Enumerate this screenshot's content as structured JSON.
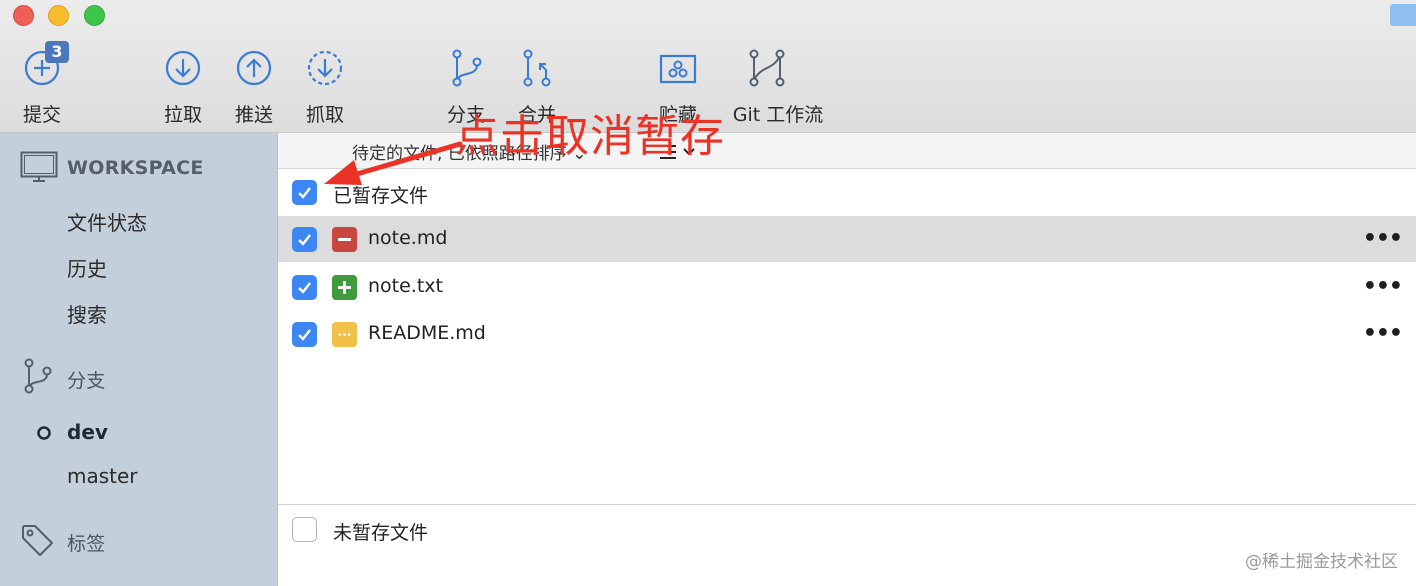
{
  "toolbar": {
    "commit": {
      "label": "提交",
      "badge": "3"
    },
    "pull": {
      "label": "拉取"
    },
    "push": {
      "label": "推送"
    },
    "fetch": {
      "label": "抓取"
    },
    "branch": {
      "label": "分支"
    },
    "merge": {
      "label": "合并"
    },
    "stash": {
      "label": "贮藏"
    },
    "gitflow": {
      "label": "Git 工作流"
    }
  },
  "sidebar": {
    "workspace_title": "WORKSPACE",
    "workspace_items": [
      "文件状态",
      "历史",
      "搜索"
    ],
    "branches_title": "分支",
    "branches": [
      {
        "name": "dev",
        "current": true
      },
      {
        "name": "master",
        "current": false
      }
    ],
    "tags_title": "标签"
  },
  "main": {
    "sort_label": "待定的文件, 已依照路径排序 ⌄",
    "list_mode_icon": "list-icon",
    "staged_title": "已暂存文件",
    "staged_files": [
      {
        "name": "note.md",
        "status": "removed",
        "selected": true
      },
      {
        "name": "note.txt",
        "status": "added",
        "selected": false
      },
      {
        "name": "README.md",
        "status": "modified",
        "selected": false
      }
    ],
    "more_label": "•••",
    "unstaged_title": "未暂存文件"
  },
  "annotation": {
    "text": "点击取消暂存",
    "color": "#ea3326"
  },
  "watermark": "@稀土掘金技术社区",
  "colors": {
    "checkbox_on": "#3d87f5",
    "status_removed": "#c9473e",
    "status_added": "#3f9b3c",
    "status_modified": "#f0c048",
    "sidebar_bg": "#c4cfdc",
    "accent_icon": "#3a7bd5"
  }
}
